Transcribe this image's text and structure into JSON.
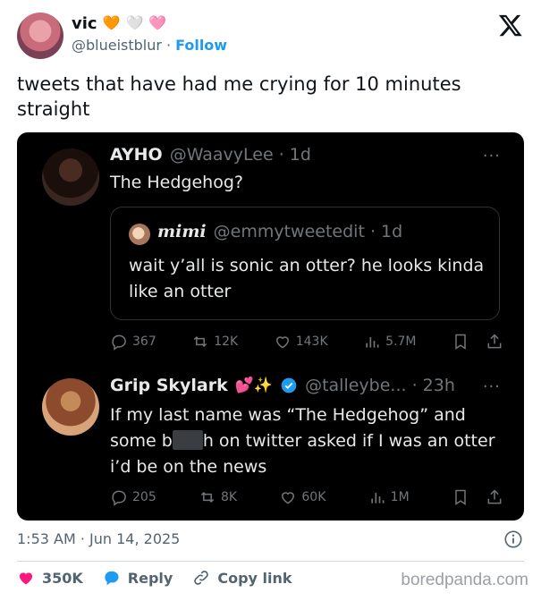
{
  "author": {
    "name": "vic",
    "emoji": [
      "🧡",
      "🤍",
      "🩷"
    ],
    "handle": "@blueistblur",
    "separator": "·",
    "follow_label": "Follow"
  },
  "tweet": {
    "text": "tweets that have had me crying for 10 minutes straight",
    "timestamp": "1:53 AM · Jun 14, 2025"
  },
  "screenshot": {
    "post1": {
      "name": "AYHO",
      "handle": "@WaavyLee · 1d",
      "text": "The Hedgehog?",
      "quote": {
        "name": "mimi",
        "handle": "@emmytweetedit · 1d",
        "text": "wait y’all is sonic an otter? he looks kinda like an otter"
      },
      "stats": {
        "replies": "367",
        "reposts": "12K",
        "likes": "143K",
        "views": "5.7M"
      }
    },
    "post2": {
      "name": "Grip Skylark",
      "emoji": "💕✨",
      "handle": "@talleybe... · 23h",
      "text_part1": "If my last name was “The Hedgehog” and some b",
      "text_part2": "h on twitter asked if I was an otter i’d be on the news",
      "stats": {
        "replies": "205",
        "reposts": "8K",
        "likes": "60K",
        "views": "1M"
      }
    },
    "more_label": "···"
  },
  "footer": {
    "likes": "350K",
    "reply_label": "Reply",
    "copy_label": "Copy link",
    "watermark": "boredpanda.com"
  },
  "colors": {
    "link": "#1d9bf0",
    "like": "#f91880",
    "reply": "#1d9bf0",
    "verified": "#1d9bf0",
    "muted": "#536471"
  }
}
